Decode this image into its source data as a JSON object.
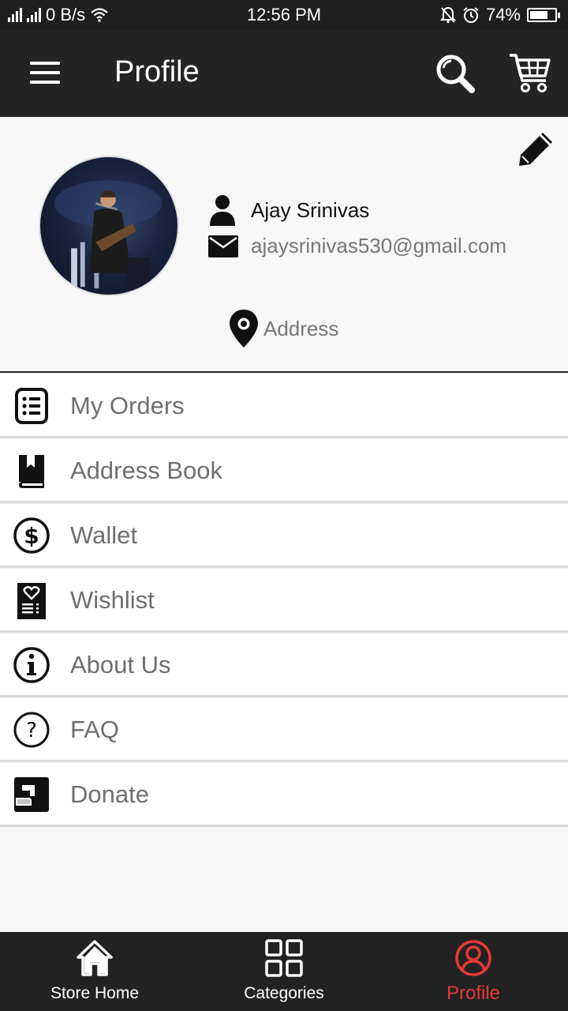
{
  "status_bar": {
    "network_speed": "0 B/s",
    "time": "12:56 PM",
    "battery": "74%",
    "battery_level": 0.74
  },
  "app_bar": {
    "title": "Profile",
    "menu_icon": "hamburger-menu-icon",
    "search_icon": "search-icon",
    "cart_icon": "shopping-cart-icon"
  },
  "profile": {
    "name": "Ajay Srinivas",
    "email": "ajaysrinivas530@gmail.com",
    "address": "Address",
    "edit_icon": "pencil-icon"
  },
  "menu": {
    "items": [
      {
        "label": "My Orders",
        "icon": "orders-list-icon"
      },
      {
        "label": "Address Book",
        "icon": "book-icon"
      },
      {
        "label": "Wallet",
        "icon": "dollar-circle-icon"
      },
      {
        "label": "Wishlist",
        "icon": "wishlist-heart-icon"
      },
      {
        "label": "About Us",
        "icon": "info-icon"
      },
      {
        "label": "FAQ",
        "icon": "question-icon"
      },
      {
        "label": "Donate",
        "icon": "donate-icon"
      }
    ]
  },
  "bottom_nav": {
    "items": [
      {
        "label": "Store Home",
        "icon": "home-icon",
        "active": false
      },
      {
        "label": "Categories",
        "icon": "grid-icon",
        "active": false
      },
      {
        "label": "Profile",
        "icon": "user-circle-icon",
        "active": true
      }
    ]
  },
  "colors": {
    "app_bar": "#242424",
    "accent_active": "#e53935",
    "background": "#f7f7f7",
    "menu_text": "#6f6f6f"
  }
}
